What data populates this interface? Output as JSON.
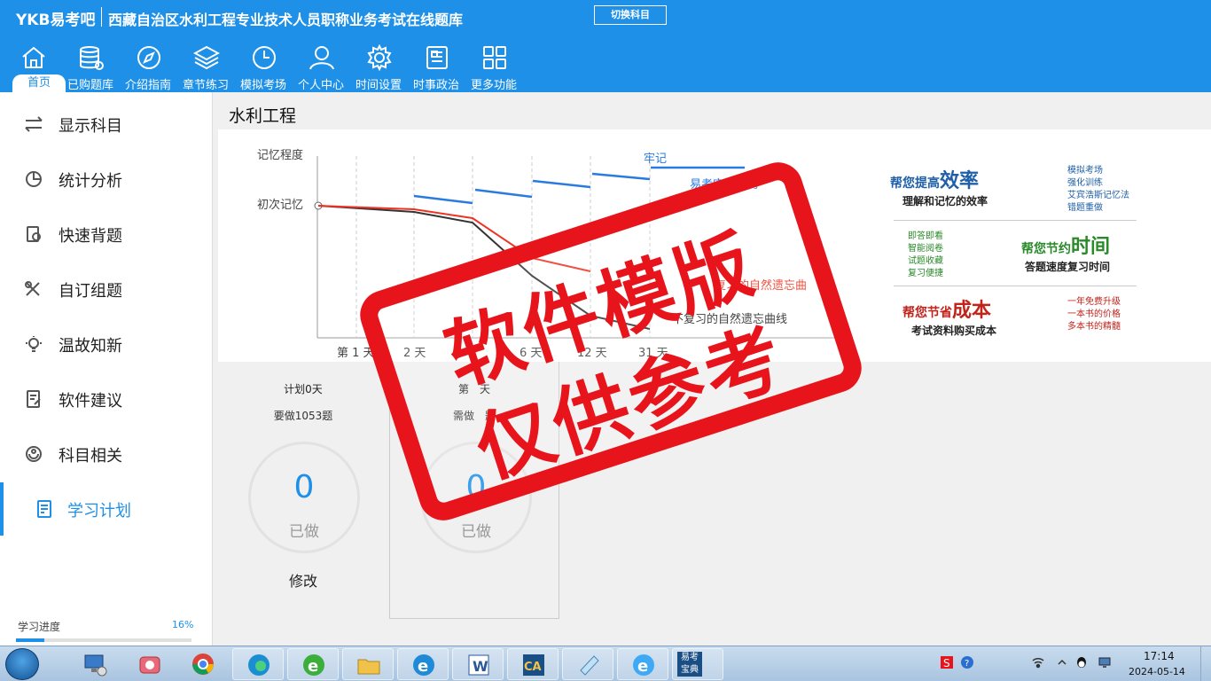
{
  "header": {
    "brand": "YKB易考吧",
    "title": "西藏自治区水利工程专业技术人员职称业务考试在线题库",
    "switch_label": "切换科目",
    "nav": [
      {
        "label": "首页",
        "icon": "home-icon"
      },
      {
        "label": "已购题库",
        "icon": "database-icon"
      },
      {
        "label": "介绍指南",
        "icon": "compass-icon"
      },
      {
        "label": "章节练习",
        "icon": "layers-icon"
      },
      {
        "label": "模拟考场",
        "icon": "clock-icon"
      },
      {
        "label": "个人中心",
        "icon": "user-icon"
      },
      {
        "label": "时间设置",
        "icon": "gear-icon"
      },
      {
        "label": "时事政治",
        "icon": "news-icon"
      },
      {
        "label": "更多功能",
        "icon": "grid-icon"
      }
    ]
  },
  "sidebar": {
    "items": [
      {
        "label": "显示科目",
        "icon": "swap-icon"
      },
      {
        "label": "统计分析",
        "icon": "pie-chart-icon"
      },
      {
        "label": "快速背题",
        "icon": "flash-card-icon"
      },
      {
        "label": "自订组题",
        "icon": "tools-icon"
      },
      {
        "label": "温故知新",
        "icon": "bulb-icon"
      },
      {
        "label": "软件建议",
        "icon": "feedback-icon"
      },
      {
        "label": "科目相关",
        "icon": "subject-icon"
      },
      {
        "label": "学习计划",
        "icon": "plan-icon"
      }
    ],
    "progress_label": "学习进度",
    "progress_value": "16%",
    "progress_fraction": 0.16
  },
  "main": {
    "title": "水利工程",
    "banner": {
      "y_label": "记忆程度",
      "first_memory": "初次记忆",
      "firm_label": "牢记",
      "ykb_curve_label": "易考宝典复习",
      "no_review_label": "不复习的自然遗忘曲线",
      "no_review_label_red": "复习的自然遗忘曲",
      "x_ticks": [
        "第 1 天",
        "2 天",
        "6 天",
        "12 天",
        "31 天"
      ],
      "promo1_pre": "帮您提高",
      "promo1_big": "效率",
      "promo1_sub": "理解和记忆的效率",
      "promo1_list": [
        "模拟考场",
        "强化训练",
        "艾宾浩斯记忆法",
        "错题重做"
      ],
      "promo2_pre": "帮您节约",
      "promo2_big": "时间",
      "promo2_sub": "答题速度复习时间",
      "promo2_list": [
        "即答即看",
        "智能阅卷",
        "试题收藏",
        "复习便捷"
      ],
      "promo3_pre": "帮您节省",
      "promo3_big": "成本",
      "promo3_sub": "考试资料购买成本",
      "promo3_list": [
        "一年免费升级",
        "一本书的价格",
        "多本书的精髓"
      ]
    },
    "plan_cards": [
      {
        "line1": "计划0天",
        "line2": "要做1053题",
        "count": "0",
        "done": "已做",
        "edit": "修改"
      },
      {
        "line1": "第　天",
        "line2": "需做　题",
        "count": "0",
        "done": "已做"
      }
    ],
    "stamp_line1": "软件模版",
    "stamp_line2": "仅供参考"
  },
  "taskbar": {
    "yk_label": "易考宝典",
    "time": "17:14",
    "date": "2024-05-14"
  },
  "colors": {
    "primary": "#1e90e8",
    "stamp": "#e8141b",
    "sidebar_bg": "#ffffff"
  }
}
